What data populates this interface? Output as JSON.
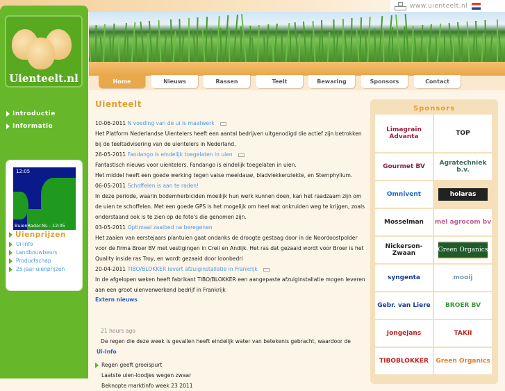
{
  "header": {
    "url": "www.uienteelt.nl",
    "logo_text": "Uienteelt.nl"
  },
  "nav": {
    "tabs": [
      {
        "label": "Home",
        "active": true
      },
      {
        "label": "Nieuws"
      },
      {
        "label": "Rassen"
      },
      {
        "label": "Teelt"
      },
      {
        "label": "Bewaring"
      },
      {
        "label": "Sponsors"
      },
      {
        "label": "Contact"
      }
    ]
  },
  "sidebar": {
    "menu": [
      "Introductie",
      "Informatie"
    ],
    "radar": {
      "time": "12:05",
      "caption": "BuienRadar.NL - 12:05"
    },
    "prices_title": "Uienprijzen",
    "price_links": [
      "Ui-Info",
      "Landbouwbeurs",
      "Productschap",
      "25 jaar uienprijzen"
    ]
  },
  "main": {
    "title": "Uienteelt",
    "news": [
      {
        "date": "10-06-2011",
        "title": "N voeding van de ui is maatwerk",
        "body": "Het Platform Nederlandse Uientelers heeft een aantal bedrijven uitgenodigd die actief zijn betrokken bij de teeltadvisering van de uientelers in Nederland."
      },
      {
        "date": "26-05-2011",
        "title": "Fandango is eindelijk toegelaten in uien",
        "body": "Fantastisch nieuws voor uientelers. Fandango is eindelijk toegelaten in uien.",
        "body2": "Het middel heeft een goede werking tegen valse meeldauw, bladvlekkenziekte, en Stemphylium."
      },
      {
        "date": "06-05-2011",
        "title": "Schoffelen is aan te raden!",
        "body": "In deze periode, waarin bodemherbiciden moeilijk hun werk kunnen doen, kan het raadzaam zijn om de uien te schoffelen. Met een goede GPS is het mogelijk om heel wat onkruiden weg te krijgen, zoals onderstaand ook is te zien op de foto's die genomen zijn."
      },
      {
        "date": "03-05-2011",
        "title": "Optimaal zaaibed na beregenen",
        "body": "Het zaaien van eerstejaars plantuien gaat ondanks de droogte gestaag door in de Noordoostpolder voor de firma Broer BV met vestigingen in Creil en Andijk. Het ras dat gezaaid wordt voor Broer is het Quality inside ras Troy, en wordt gezaaid door loonbedri"
      },
      {
        "date": "20-04-2011",
        "title": "TIBO/BLOKKER levert afzuiginstallatie in Frankrijk",
        "body": "In de afgelopen weken heeft fabrikant TIBO/BLOKKER een aangepaste afzuiginstallatie mogen leveren aan een groot uienverwerkend bedrijf in Frankrijk"
      }
    ],
    "extern_title": "Extern nieuws",
    "extern_time": "21 hours ago",
    "extern_text": "De regen die deze week is gevallen heeft eindelijk water van betekenis gebracht, waardoor de",
    "uiinfo_title": "Ui-Info",
    "uiinfo_items": [
      "Regen geeft groeispurt",
      "Laatste uien-loodjes wegen zwaar",
      "Beknopte marktinfo week 23 2011"
    ]
  },
  "sponsors": {
    "title": "Sponsors",
    "logos": [
      "Limagrain Advanta",
      "TOP",
      "Gourmet BV",
      "Agratechniek b.v.",
      "Omnivent",
      "holaras",
      "Mosselman",
      "mel agrocom bv",
      "Nickerson-Zwaan",
      "Green Organics",
      "syngenta",
      "mooij",
      "Gebr. van Liere",
      "BROER BV",
      "Jongejans",
      "TAKII",
      "TIBOBLOKKER",
      "Green Organics"
    ]
  }
}
